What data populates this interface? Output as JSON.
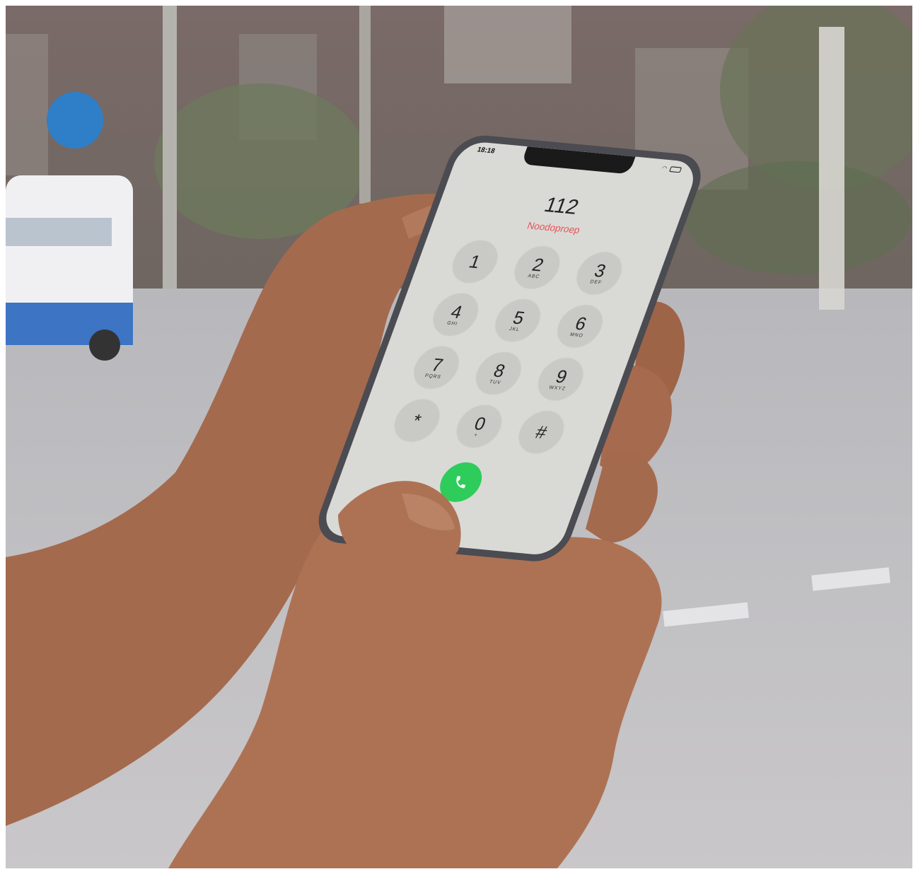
{
  "status_bar": {
    "time": "18:18"
  },
  "dialer": {
    "number": "112",
    "label": "Noodoproep",
    "label_color": "#e8525a",
    "call_button_color": "#2ecc5a",
    "call_icon": "phone-handset-icon",
    "keys": [
      {
        "num": "1",
        "letters": ""
      },
      {
        "num": "2",
        "letters": "ABC"
      },
      {
        "num": "3",
        "letters": "DEF"
      },
      {
        "num": "4",
        "letters": "GHI"
      },
      {
        "num": "5",
        "letters": "JKL"
      },
      {
        "num": "6",
        "letters": "MNO"
      },
      {
        "num": "7",
        "letters": "PQRS"
      },
      {
        "num": "8",
        "letters": "TUV"
      },
      {
        "num": "9",
        "letters": "WXYZ"
      },
      {
        "num": "*",
        "letters": ""
      },
      {
        "num": "0",
        "letters": "+"
      },
      {
        "num": "#",
        "letters": ""
      }
    ]
  }
}
